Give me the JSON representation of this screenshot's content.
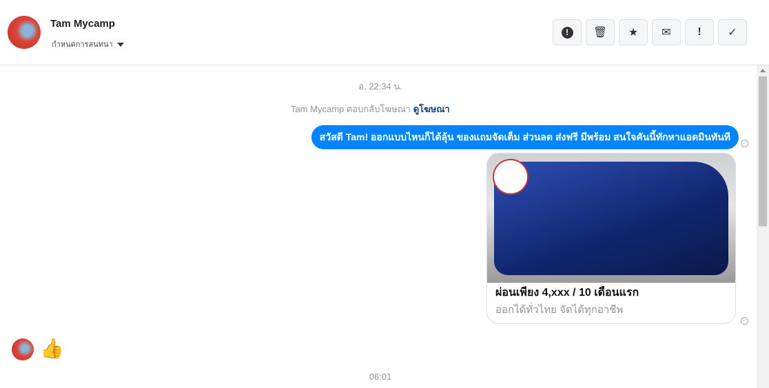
{
  "header": {
    "name": "Tam Mycamp",
    "subtitle": "กำหนดการสนทนา",
    "actions": [
      {
        "name": "spam",
        "glyph": "!"
      },
      {
        "name": "delete",
        "glyph": "🗑"
      },
      {
        "name": "star",
        "glyph": "★"
      },
      {
        "name": "unread",
        "glyph": "✉"
      },
      {
        "name": "important",
        "glyph": "!"
      },
      {
        "name": "done",
        "glyph": "✓"
      }
    ]
  },
  "messages": {
    "time1": "อ. 22:34 น.",
    "reply_note": "Tam Mycamp ตอบกลับโฆษณา",
    "view_ad": "ดูโฆษณา",
    "outgoing": "สวัสดี Tam! ออกแบบไหนก็ได้ลุ้น ของแถมจัดเต็ม ส่วนลด ส่งฟรี มีพร้อม สนใจคันนี้ทักหาแอดมินทันที",
    "card_title": "ผ่อนเพียง 4,xxx / 10 เดือนแรก",
    "card_subtitle": "ออกได้ทั่วไทย จัดได้ทุกอาชีพ",
    "reaction": "👍",
    "time2": "06:01"
  },
  "colors": {
    "accent": "#0084ff"
  }
}
